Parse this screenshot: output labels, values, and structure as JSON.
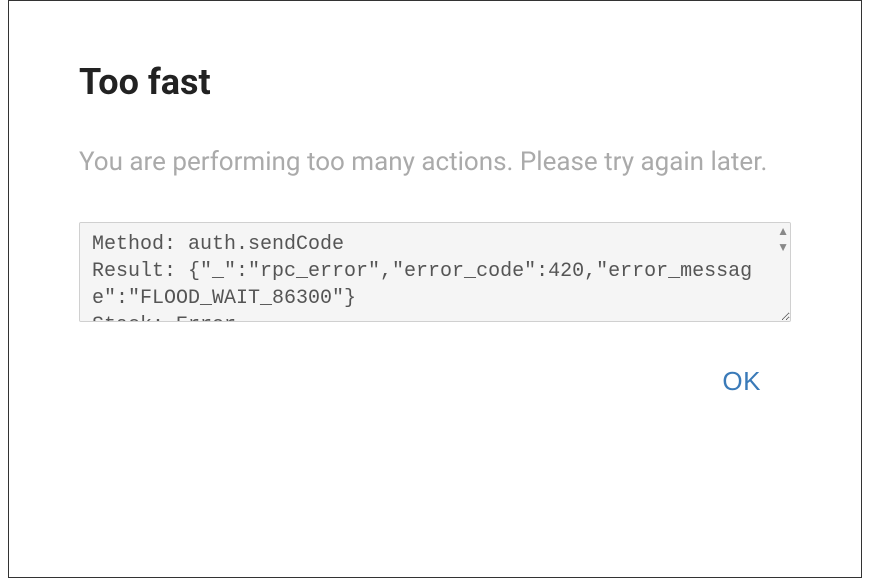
{
  "dialog": {
    "title": "Too fast",
    "message": "You are performing too many actions. Please try again later.",
    "error_text": "Method: auth.sendCode\nResult: {\"_\":\"rpc_error\",\"error_code\":420,\"error_message\":\"FLOOD_WAIT_86300\"}\nStack: Error",
    "ok_label": "OK"
  }
}
